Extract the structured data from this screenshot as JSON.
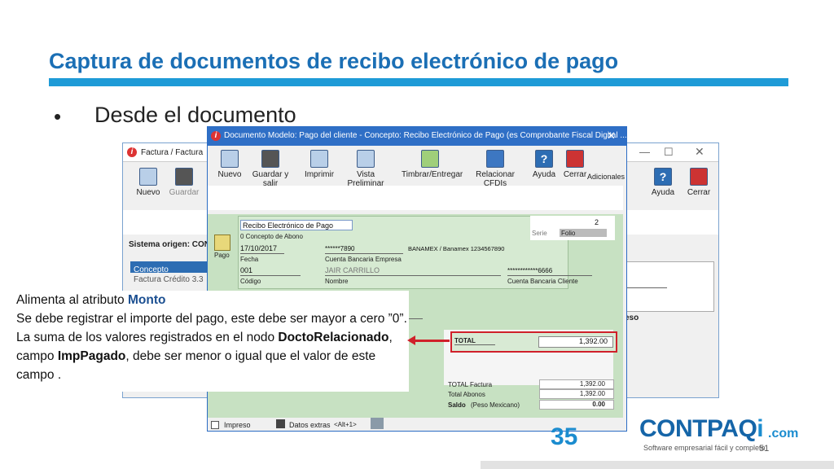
{
  "slide": {
    "title": "Captura de documentos de recibo electrónico de pago",
    "bullet": "•",
    "bullet_text": "Desde el documento",
    "page_number": "51"
  },
  "back_window": {
    "title": "Factura / Factura",
    "toolbar": {
      "nuevo": "Nuevo",
      "guardar": "Guardar",
      "guardar_right": "dar",
      "ayuda": "Ayuda",
      "cerrar": "Cerrar"
    },
    "sistema_origen": "Sistema origen: CON",
    "concepto_header": "Concepto",
    "concepto_value": "Factura Crédito 3.3",
    "peso_text": "eso"
  },
  "front_window": {
    "title": "Documento Modelo: Pago del cliente - Concepto: Recibo Electrónico de Pago (es Comprobante Fiscal Digital ...",
    "toolbar": {
      "nuevo": "Nuevo",
      "guardar_salir": "Guardar y salir",
      "imprimir": "Imprimir",
      "vista_preliminar": "Vista Preliminar",
      "timbrar": "Timbrar/Entregar",
      "relacionar_cfdis": "Relacionar CFDIs",
      "ayuda": "Ayuda",
      "cerrar": "Cerrar",
      "adicionales": "Adicionales"
    },
    "pago_label": "Pago",
    "concepto_value": "Recibo Electrónico de Pago",
    "concepto_label": "0 Concepto de Abono",
    "serie_label": "Serie",
    "folio_label": "Folio",
    "folio_value": "2",
    "fecha_value": "17/10/2017",
    "fecha_label": "Fecha",
    "cuenta_bancaria_empresa_value": "******7890",
    "cuenta_bancaria_empresa_label": "Cuenta Bancaria Empresa",
    "banco_value": "BANAMEX / Banamex 1234567890",
    "codigo_value": "001",
    "codigo_label": "Código",
    "nombre_value": "JAIR CARRILLO",
    "nombre_label": "Nombre",
    "cuenta_cliente_value": "************6666",
    "cuenta_cliente_label": "Cuenta Bancaria Cliente",
    "total_label": "TOTAL",
    "total_value": "1,392.00",
    "total_factura_label": "TOTAL Factura",
    "total_factura_value": "1,392.00",
    "total_abonos_label": "Total Abonos",
    "total_abonos_value": "1,392.00",
    "saldo_label": "Saldo",
    "saldo_currency": "(Peso Mexicano)",
    "saldo_value": "0.00",
    "impreso_label": "Impreso",
    "datos_extras_label": "Datos extras",
    "datos_extras_shortcut": "<Alt+1>"
  },
  "callout": {
    "line1_prefix": "Alimenta al atributo ",
    "line1_bold": "Monto",
    "line2": "Se debe registrar el importe del pago, este debe ser mayor a cero ”0”. La suma de los valores registrados en el nodo ",
    "bold2": "DoctoRelacionado",
    "mid": ", campo ",
    "bold3": "ImpPagado",
    "tail": ", debe ser menor o igual que el valor de este campo ."
  },
  "logo": {
    "word": "CONTPAQ",
    "i": "i",
    "com": ".com",
    "slogan": "Software empresarial fácil y completo",
    "anniversary": "35"
  },
  "colors": {
    "title": "#1b6fb5",
    "accent_bar": "#1f9bd7",
    "highlight_red": "#d0202a",
    "pago_panel_bg": "#c7e1c2",
    "callout_bold_blue": "#1b4f91"
  }
}
